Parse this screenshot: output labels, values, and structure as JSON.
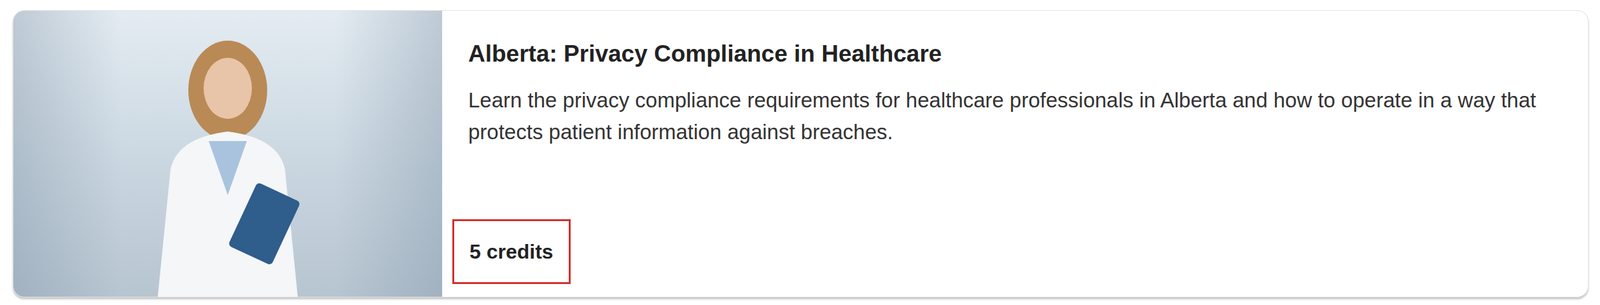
{
  "card": {
    "title": "Alberta: Privacy Compliance in Healthcare",
    "description": "Learn the privacy compliance requirements for healthcare professionals in Alberta and how to operate in a way that protects patient information against breaches.",
    "credits": {
      "label": "5 credits",
      "highlighted": true
    }
  }
}
